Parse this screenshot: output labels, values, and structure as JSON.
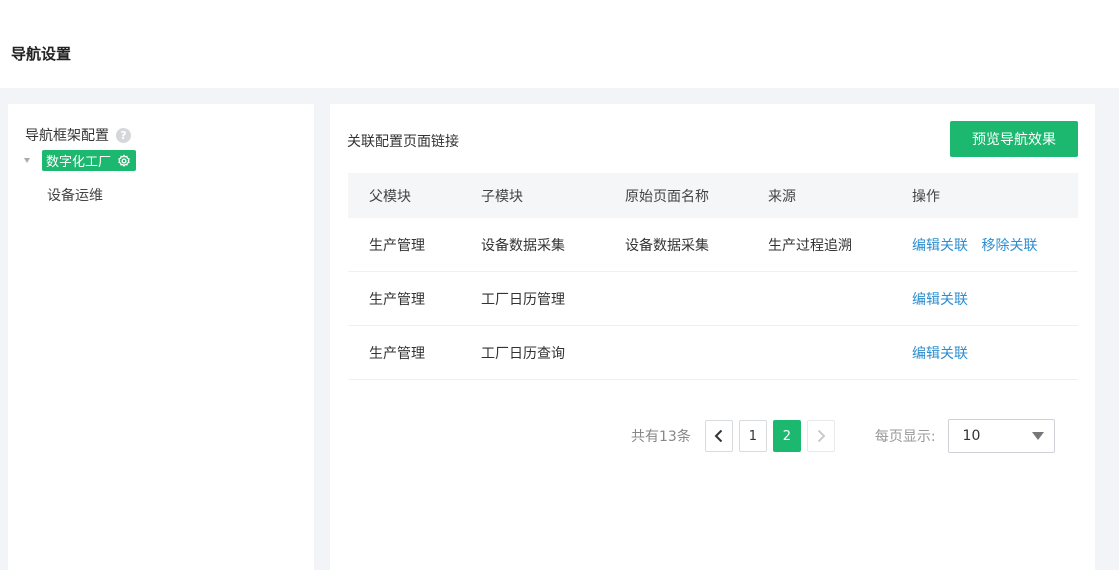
{
  "page": {
    "title": "导航设置"
  },
  "left_panel": {
    "tree_title": "导航框架配置",
    "help_glyph": "?",
    "root_node": {
      "label": "数字化工厂"
    },
    "children": [
      {
        "label": "设备运维"
      }
    ]
  },
  "right_panel": {
    "title": "关联配置页面链接",
    "preview_button": "预览导航效果",
    "table": {
      "columns": [
        "父模块",
        "子模块",
        "原始页面名称",
        "来源",
        "操作"
      ],
      "rows": [
        {
          "parent": "生产管理",
          "child": "设备数据采集",
          "original_name": "设备数据采集",
          "source": "生产过程追溯",
          "actions": [
            "编辑关联",
            "移除关联"
          ]
        },
        {
          "parent": "生产管理",
          "child": "工厂日历管理",
          "original_name": "",
          "source": "",
          "actions": [
            "编辑关联"
          ]
        },
        {
          "parent": "生产管理",
          "child": "工厂日历查询",
          "original_name": "",
          "source": "",
          "actions": [
            "编辑关联"
          ]
        }
      ]
    },
    "pagination": {
      "total_text": "共有13条",
      "prev_glyph": "<",
      "next_glyph": ">",
      "pages": [
        "1",
        "2"
      ],
      "current_page": "2",
      "per_page_label": "每页显示:",
      "per_page_value": "10"
    }
  },
  "colors": {
    "accent": "#1db86f",
    "link": "#2d8ecf"
  },
  "icons": {
    "help": "question-circle-icon",
    "gear": "gear-icon",
    "caret": "caret-down-icon"
  }
}
